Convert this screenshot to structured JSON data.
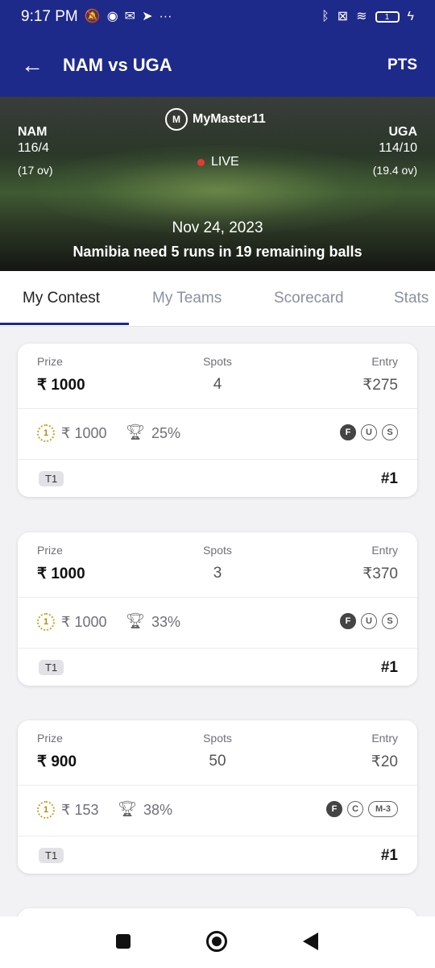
{
  "status_bar": {
    "time": "9:17 PM",
    "battery": "1"
  },
  "app_bar": {
    "title": "NAM vs UGA",
    "right_action": "PTS"
  },
  "match": {
    "brand": "MyMaster11",
    "team1": {
      "code": "NAM",
      "score": "116/4",
      "overs": "(17 ov)"
    },
    "team2": {
      "code": "UGA",
      "score": "114/10",
      "overs": "(19.4 ov)"
    },
    "live_label": "LIVE",
    "date": "Nov 24, 2023",
    "status": "Namibia need 5 runs in 19 remaining balls"
  },
  "tabs": [
    {
      "label": "My Contest",
      "active": true
    },
    {
      "label": "My Teams",
      "active": false
    },
    {
      "label": "Scorecard",
      "active": false
    },
    {
      "label": "Stats",
      "active": false
    }
  ],
  "contest_labels": {
    "prize": "Prize",
    "spots": "Spots",
    "entry": "Entry"
  },
  "contests": [
    {
      "prize": "₹ 1000",
      "spots": "4",
      "entry": "₹275",
      "first_prize": "₹ 1000",
      "win_pct": "25%",
      "badges": [
        "F",
        "U",
        "S"
      ],
      "team": "T1",
      "rank": "#1"
    },
    {
      "prize": "₹ 1000",
      "spots": "3",
      "entry": "₹370",
      "first_prize": "₹ 1000",
      "win_pct": "33%",
      "badges": [
        "F",
        "U",
        "S"
      ],
      "team": "T1",
      "rank": "#1"
    },
    {
      "prize": "₹ 900",
      "spots": "50",
      "entry": "₹20",
      "first_prize": "₹ 153",
      "win_pct": "38%",
      "badges": [
        "F",
        "C",
        "M-3"
      ],
      "team": "T1",
      "rank": "#1"
    }
  ],
  "colors": {
    "primary": "#1e2a8a",
    "live_dot": "#e53935"
  }
}
